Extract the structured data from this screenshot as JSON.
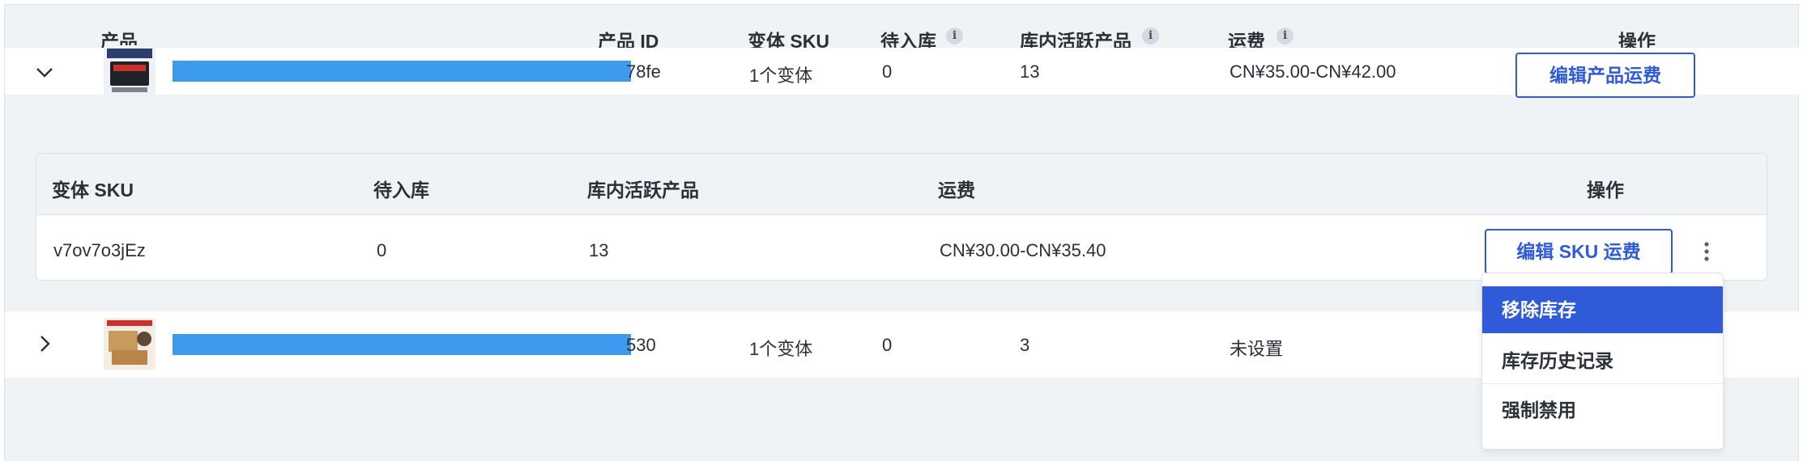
{
  "table": {
    "headers": {
      "product": "产品",
      "product_id": "产品 ID",
      "variant_sku": "变体 SKU",
      "pending": "待入库",
      "active": "库内活跃产品",
      "shipping": "运费",
      "actions": "操作",
      "info_glyph": "i"
    },
    "rows": [
      {
        "id_suffix": "78fe",
        "variants": "1个变体",
        "pending": "0",
        "active": "13",
        "shipping": "CN¥35.00-CN¥42.00",
        "action_label": "编辑产品运费",
        "expanded": true
      },
      {
        "id_suffix": "530",
        "variants": "1个变体",
        "pending": "0",
        "active": "3",
        "shipping": "未设置",
        "expanded": false
      }
    ]
  },
  "variant_table": {
    "headers": {
      "sku": "变体 SKU",
      "pending": "待入库",
      "active": "库内活跃产品",
      "shipping": "运费",
      "actions": "操作"
    },
    "rows": [
      {
        "sku": "v7ov7o3jEz",
        "pending": "0",
        "active": "13",
        "shipping": "CN¥30.00-CN¥35.40",
        "action_label": "编辑 SKU 运费"
      }
    ]
  },
  "menu": {
    "items": [
      "移除库存",
      "库存历史记录",
      "强制禁用"
    ],
    "active_index": 0
  },
  "colors": {
    "accent": "#2f5bd8",
    "redaction": "#3d9bef",
    "header_bg": "#f0f3f6"
  },
  "icons": [
    "info-icon",
    "chevron-down-icon",
    "chevron-right-icon",
    "more-vertical-icon"
  ]
}
